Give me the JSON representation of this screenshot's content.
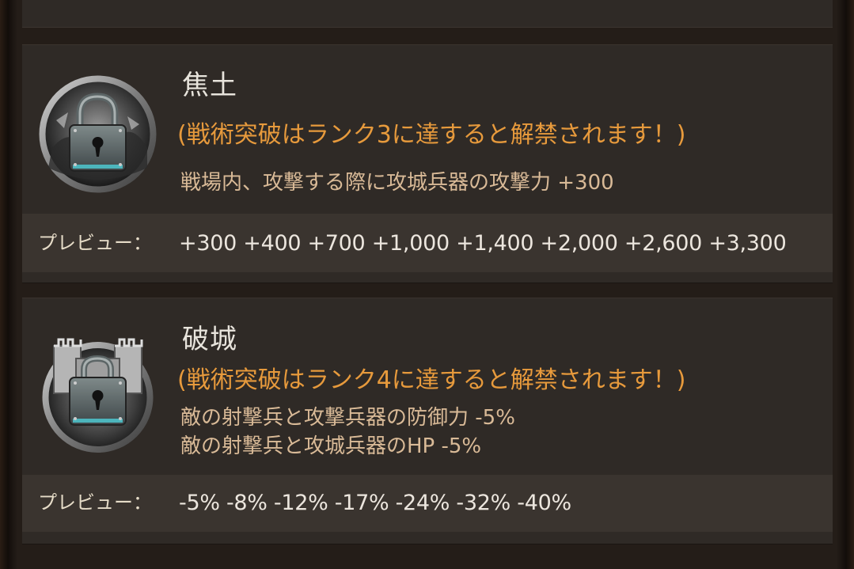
{
  "talents": [
    {
      "name": "焦土",
      "unlock_note": "(戦術突破はランク3に達すると解禁されます！)",
      "effects": [
        "戦場内、攻撃する際に攻城兵器の攻撃力 +300"
      ],
      "preview_label": "プレビュー：",
      "preview_values": "+300 +400 +700 +1,000 +1,400 +2,000 +2,600 +3,300",
      "icon": "locked-scorched-earth-icon"
    },
    {
      "name": "破城",
      "unlock_note": "(戦術突破はランク4に達すると解禁されます！)",
      "effects": [
        "敵の射撃兵と攻撃兵器の防御力 -5%",
        "敵の射撃兵と攻城兵器のHP -5%"
      ],
      "preview_label": "プレビュー：",
      "preview_values": "-5% -8% -12% -17% -24% -32% -40%",
      "icon": "locked-castle-icon"
    }
  ],
  "colors": {
    "unlock_text": "#e79a3c",
    "effect_text": "#d9ba97",
    "title_text": "#e8e4dc",
    "card_bg": "#2f2a26",
    "preview_bg": "#3a342f"
  }
}
